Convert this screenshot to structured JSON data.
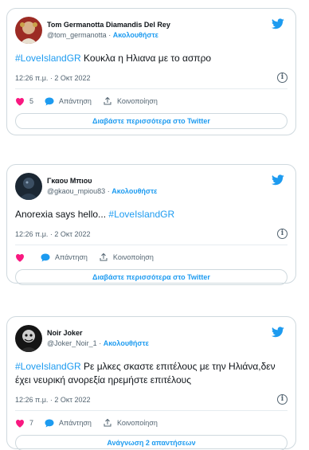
{
  "colors": {
    "accent": "#1d9bf0",
    "like": "#f91880",
    "border": "#cfd9de",
    "muted": "#536471"
  },
  "tweets": [
    {
      "display_name": "Tom Germanotta Diamandis Del Rey",
      "handle": "@tom_germanotta",
      "separator": "·",
      "follow_label": "Ακολουθήστε",
      "hashtag": "#LoveIslandGR",
      "text": " Κουκλα η Ηλιανα με το ασπρο",
      "timestamp": "12:26 π.μ. · 2 Οκτ 2022",
      "like_count": "5",
      "reply_label": "Απάντηση",
      "share_label": "Κοινοποίηση",
      "cta_label": "Διαβάστε περισσότερα στο Twitter"
    },
    {
      "display_name": "Γκαου Μπιου",
      "handle": "@gkaou_mpiou83",
      "separator": "·",
      "follow_label": "Ακολουθήστε",
      "text_before": "Anorexia says hello... ",
      "hashtag": "#LoveIslandGR",
      "timestamp": "12:26 π.μ. · 2 Οκτ 2022",
      "like_count": "",
      "reply_label": "Απάντηση",
      "share_label": "Κοινοποίηση",
      "cta_label": "Διαβάστε περισσότερα στο Twitter"
    },
    {
      "display_name": "Noir Joker",
      "handle": "@Joker_Noir_1",
      "separator": "·",
      "follow_label": "Ακολουθήστε",
      "hashtag": "#LoveIslandGR",
      "text": " Ρε μλκες σκαστε επιτέλους με την Ηλιάνα,δεν έχει νευρική ανορεξία ηρεμήστε επιτέλους",
      "timestamp": "12:26 π.μ. · 2 Οκτ 2022",
      "like_count": "7",
      "reply_label": "Απάντηση",
      "share_label": "Κοινοποίηση",
      "cta_label": "Ανάγνωση 2 απαντήσεων"
    }
  ]
}
